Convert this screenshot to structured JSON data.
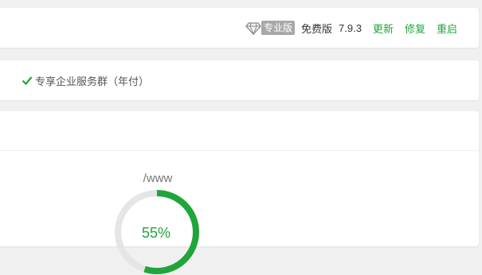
{
  "header": {
    "pro_badge": "专业版",
    "edition": "免费版",
    "version": "7.9.3",
    "actions": [
      "更新",
      "修复",
      "重启"
    ]
  },
  "features": {
    "partial_prev": "）",
    "item": "专享企业服务群（年付）"
  },
  "disk": {
    "path": "/www",
    "usage_percent": 55,
    "usage_label": "55%"
  },
  "colors": {
    "accent": "#20a53a",
    "badge_bg": "#a8a8a8",
    "gauge_track": "#e5e5e5"
  },
  "icons": [
    "diamond-icon",
    "check-icon"
  ]
}
